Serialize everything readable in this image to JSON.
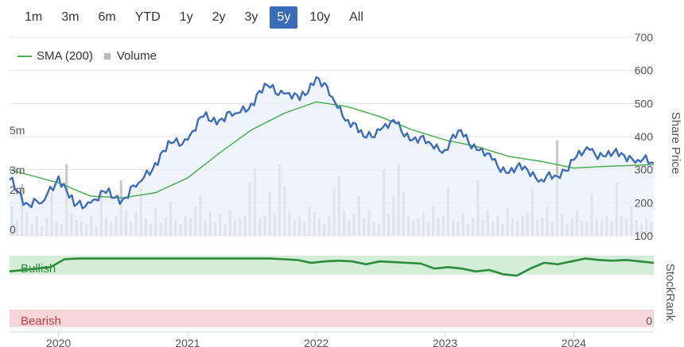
{
  "range_buttons": [
    {
      "label": "1m",
      "active": false
    },
    {
      "label": "3m",
      "active": false
    },
    {
      "label": "6m",
      "active": false
    },
    {
      "label": "YTD",
      "active": false
    },
    {
      "label": "1y",
      "active": false
    },
    {
      "label": "2y",
      "active": false
    },
    {
      "label": "3y",
      "active": false
    },
    {
      "label": "5y",
      "active": true
    },
    {
      "label": "10y",
      "active": false
    },
    {
      "label": "All",
      "active": false
    }
  ],
  "legend": {
    "sma_label": "SMA (200)",
    "volume_label": "Volume"
  },
  "colors": {
    "price": "#3d6db8",
    "sma": "#4caf50",
    "volume": "#c8c8c8",
    "bullish_band": "#d4edd6",
    "bearish_band": "#f6d6d8",
    "stockrank": "#2e8b3e",
    "stockrank_low": "#999999"
  },
  "chart_data": {
    "type": "line",
    "x_ticks": [
      "2020",
      "2021",
      "2022",
      "2023",
      "2024"
    ],
    "x_range": [
      "2019-08-15",
      "2024-08-15"
    ],
    "right_axis": {
      "title": "Share Price",
      "ticks": [
        700,
        600,
        500,
        400,
        300,
        200,
        100
      ],
      "range": [
        100,
        700
      ]
    },
    "left_axis": {
      "ticks": [
        "5m",
        "3m",
        "2m",
        "0"
      ],
      "tick_values": [
        5,
        3,
        2,
        0
      ],
      "range": [
        0,
        10
      ]
    },
    "series": [
      {
        "name": "price",
        "x": [
          "2019-08-15",
          "2019-10-01",
          "2019-11-15",
          "2020-01-01",
          "2020-02-15",
          "2020-04-01",
          "2020-05-15",
          "2020-07-01",
          "2020-08-15",
          "2020-10-01",
          "2020-11-15",
          "2021-01-01",
          "2021-02-15",
          "2021-04-01",
          "2021-05-15",
          "2021-07-01",
          "2021-08-15",
          "2021-10-01",
          "2021-11-15",
          "2022-01-01",
          "2022-02-15",
          "2022-04-01",
          "2022-05-15",
          "2022-07-01",
          "2022-08-15",
          "2022-10-01",
          "2022-11-15",
          "2023-01-01",
          "2023-02-15",
          "2023-04-01",
          "2023-05-15",
          "2023-07-01",
          "2023-08-15",
          "2023-10-01",
          "2023-11-15",
          "2024-01-01",
          "2024-02-15",
          "2024-04-01",
          "2024-05-15",
          "2024-07-01",
          "2024-08-15"
        ],
        "values": [
          270,
          200,
          200,
          280,
          190,
          200,
          230,
          210,
          260,
          320,
          380,
          390,
          460,
          450,
          470,
          500,
          555,
          530,
          510,
          580,
          520,
          450,
          400,
          420,
          440,
          390,
          385,
          360,
          420,
          360,
          330,
          290,
          310,
          270,
          280,
          330,
          360,
          340,
          350,
          330,
          320
        ]
      },
      {
        "name": "SMA (200)",
        "x": [
          "2019-08-15",
          "2020-01-01",
          "2020-04-01",
          "2020-07-01",
          "2020-10-01",
          "2021-01-01",
          "2021-04-01",
          "2021-07-01",
          "2021-10-01",
          "2022-01-01",
          "2022-04-01",
          "2022-07-01",
          "2022-10-01",
          "2023-01-01",
          "2023-04-01",
          "2023-07-01",
          "2023-10-01",
          "2024-01-01",
          "2024-04-01",
          "2024-08-15"
        ],
        "values": [
          300,
          260,
          220,
          215,
          230,
          275,
          350,
          420,
          470,
          505,
          490,
          460,
          420,
          390,
          370,
          340,
          325,
          305,
          310,
          315
        ]
      }
    ],
    "volume_bars": [
      1.5,
      0.8,
      2.6,
      1.2,
      0.6,
      1.0,
      0.5,
      0.9,
      2.2,
      0.7,
      0.6,
      3.6,
      1.1,
      0.8,
      0.7,
      0.6,
      1.0,
      0.5,
      2.1,
      0.9,
      0.7,
      1.0,
      2.8,
      1.3,
      0.7,
      1.2,
      2.4,
      0.9,
      0.6,
      1.4,
      0.7,
      0.9,
      1.7,
      0.8,
      0.6,
      1.0,
      0.9,
      1.5,
      2.0,
      0.8,
      1.2,
      0.7,
      1.1,
      0.6,
      1.3,
      0.8,
      0.9,
      1.0,
      2.7,
      3.4,
      0.9,
      1.0,
      2.2,
      1.1,
      3.6,
      2.5,
      1.2,
      0.8,
      1.0,
      0.7,
      1.5,
      1.2,
      0.9,
      0.6,
      1.0,
      2.4,
      3.0,
      1.3,
      0.8,
      1.1,
      2.0,
      0.9,
      1.3,
      0.7,
      0.6,
      3.3,
      1.1,
      2.0,
      3.6,
      2.2,
      1.0,
      0.8,
      0.9,
      1.2,
      0.7,
      1.5,
      0.9,
      1.0,
      2.5,
      0.8,
      0.7,
      1.1,
      0.6,
      0.9,
      2.8,
      0.8,
      1.3,
      0.7,
      1.0,
      0.6,
      1.4,
      0.9,
      0.8,
      1.0,
      1.2,
      2.4,
      0.8,
      0.9,
      1.5,
      0.7,
      4.8,
      1.1,
      0.6,
      0.9,
      1.3,
      0.8,
      0.7,
      2.1,
      0.9,
      0.8,
      1.0,
      0.7,
      2.7,
      1.0,
      0.9,
      1.5,
      0.8,
      0.6,
      0.9,
      0.7
    ],
    "stockrank": {
      "labels": {
        "bullish": "Bullish",
        "bearish": "Bearish",
        "title": "StockRank",
        "bottom_tick": "0"
      },
      "values": [
        78,
        80,
        82,
        84,
        95,
        96,
        96,
        96,
        96,
        96,
        96,
        96,
        96,
        96,
        96,
        96,
        96,
        96,
        96,
        96,
        95,
        94,
        90,
        92,
        93,
        92,
        88,
        92,
        91,
        90,
        89,
        82,
        84,
        82,
        78,
        80,
        74,
        72,
        82,
        90,
        88,
        92,
        96,
        94,
        93,
        94,
        92,
        90
      ]
    }
  }
}
